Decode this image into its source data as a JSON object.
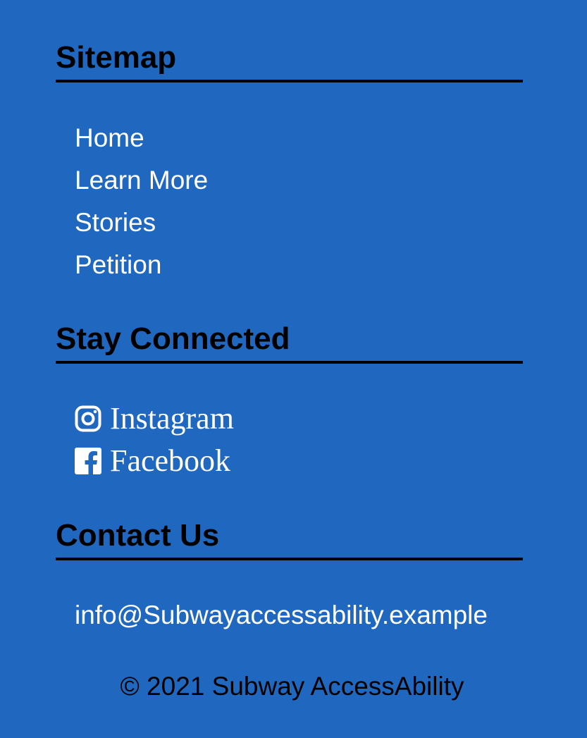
{
  "sitemap": {
    "title": "Sitemap",
    "links": [
      {
        "label": "Home"
      },
      {
        "label": "Learn More"
      },
      {
        "label": "Stories"
      },
      {
        "label": "Petition"
      }
    ]
  },
  "social": {
    "title": "Stay Connected",
    "links": [
      {
        "label": "Instagram",
        "icon": "instagram-icon"
      },
      {
        "label": "Facebook",
        "icon": "facebook-icon"
      }
    ]
  },
  "contact": {
    "title": "Contact Us",
    "email": "info@Subwayaccessability.example"
  },
  "footer": {
    "copyright": "© 2021 Subway AccessAbility"
  },
  "colors": {
    "background": "#2068bf",
    "heading": "#000000",
    "link": "#ffffff"
  }
}
